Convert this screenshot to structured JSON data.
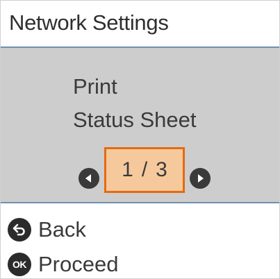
{
  "header": {
    "title": "Network Settings"
  },
  "menu": {
    "line1": "Print",
    "line2": "Status Sheet",
    "pager": {
      "current": "1",
      "separator": "/",
      "total": "3"
    }
  },
  "footer": {
    "back_label": "Back",
    "proceed_label": "Proceed",
    "ok_icon_text": "OK"
  },
  "colors": {
    "panel_bg": "#cdcdcd",
    "pager_fill": "#f6c99d",
    "pager_border": "#e46a10",
    "rule": "#6f8fb0",
    "icon_dark": "#2b2b2b"
  },
  "icons": {
    "prev": "left-arrow-circle-icon",
    "next": "right-arrow-circle-icon",
    "back": "back-arrow-circle-icon",
    "ok": "ok-circle-icon"
  }
}
